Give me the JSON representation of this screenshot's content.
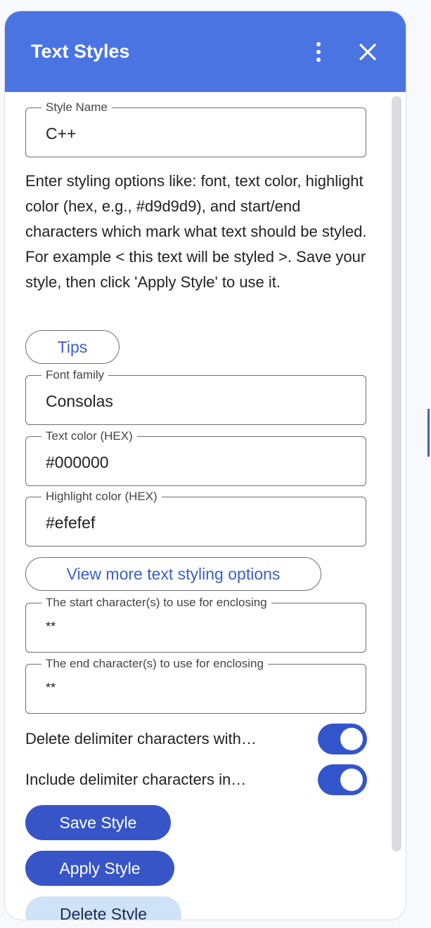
{
  "header": {
    "title": "Text Styles",
    "menu_icon": "more-vert-icon",
    "close_icon": "close-icon"
  },
  "form": {
    "style_name": {
      "label": "Style Name",
      "value": "C++"
    },
    "description": "Enter styling options like: font, text color, highlight color (hex, e.g., #d9d9d9), and start/end characters which mark what text should be styled. For example < this text will be styled >. Save your style, then click 'Apply Style' to use it.",
    "tips_label": "Tips",
    "font_family": {
      "label": "Font family",
      "value": "Consolas"
    },
    "text_color": {
      "label": "Text color (HEX)",
      "value": "#000000"
    },
    "highlight_color": {
      "label": "Highlight color (HEX)",
      "value": "#efefef"
    },
    "more_options_label": "View more text styling options",
    "start_chars": {
      "label": "The start character(s) to use for enclosing",
      "value": "**"
    },
    "end_chars": {
      "label": "The end character(s) to use for enclosing",
      "value": "**"
    },
    "toggles": [
      {
        "label": "Delete delimiter characters with…",
        "on": true
      },
      {
        "label": "Include delimiter characters in…",
        "on": true
      }
    ],
    "save_label": "Save Style",
    "apply_label": "Apply Style",
    "delete_label": "Delete Style"
  },
  "colors": {
    "header_bg": "#4a74e2",
    "primary_button": "#3855c7",
    "toggle_on": "#3355cc",
    "secondary_button": "#cfe3f8",
    "link_text": "#3b5fce"
  }
}
